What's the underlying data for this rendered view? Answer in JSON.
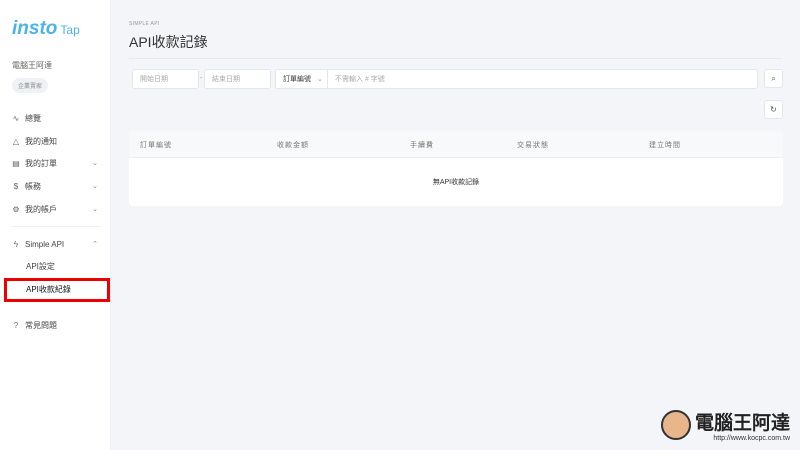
{
  "sidebar": {
    "logo": "insto",
    "logo_suffix": "Tap",
    "user_name": "電腦王阿達",
    "user_badge": "企業賣家",
    "items": [
      {
        "icon": "activity-icon",
        "label": "總覽"
      },
      {
        "icon": "bell-icon",
        "label": "我的通知"
      },
      {
        "icon": "document-icon",
        "label": "我的訂單"
      },
      {
        "icon": "dollar-icon",
        "label": "帳務"
      },
      {
        "icon": "gear-icon",
        "label": "我的帳戶"
      },
      {
        "icon": "bolt-icon",
        "label": "Simple API"
      },
      {
        "label": "API設定"
      },
      {
        "label": "API收款紀錄"
      },
      {
        "icon": "help-icon",
        "label": "常見問題"
      }
    ]
  },
  "main": {
    "breadcrumb": "SIMPLE API",
    "title": "API收款記錄",
    "filters": {
      "start_date_placeholder": "開始日期",
      "separator": "-",
      "end_date_placeholder": "結束日期",
      "field_select": "訂單編號",
      "keyword_placeholder": "不需輸入 # 字號"
    },
    "table": {
      "columns": [
        "訂單編號",
        "收款金額",
        "手續費",
        "交易狀態",
        "建立時間"
      ],
      "empty_text": "無API收款記錄"
    }
  },
  "watermark": {
    "text": "電腦王阿達",
    "url": "http://www.kocpc.com.tw"
  }
}
